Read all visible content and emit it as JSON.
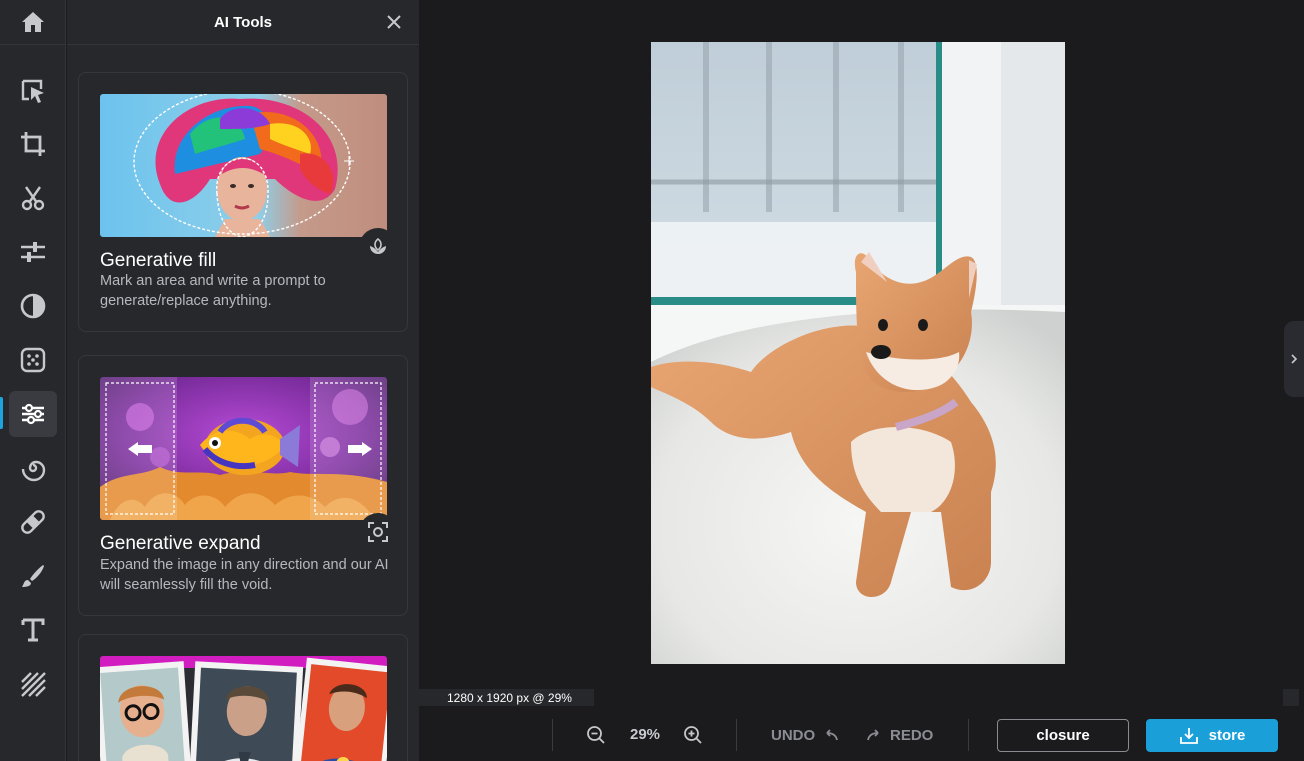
{
  "panel": {
    "title": "AI Tools",
    "cards": [
      {
        "title": "Generative fill",
        "description": "Mark an area and write a prompt to generate/replace anything.",
        "badge_icon": "sprout-icon"
      },
      {
        "title": "Generative expand",
        "description": "Expand the image in any direction and our AI will seamlessly fill the void.",
        "badge_icon": "focus-frame-icon"
      }
    ]
  },
  "sidebar": {
    "items": [
      {
        "name": "home",
        "icon": "home-icon"
      },
      {
        "name": "select",
        "icon": "cursor-select-icon"
      },
      {
        "name": "crop",
        "icon": "crop-icon"
      },
      {
        "name": "cut",
        "icon": "scissors-icon"
      },
      {
        "name": "adjust",
        "icon": "sliders-icon"
      },
      {
        "name": "filters",
        "icon": "contrast-icon"
      },
      {
        "name": "effects",
        "icon": "dots-grid-icon"
      },
      {
        "name": "ai-tools",
        "icon": "ai-tools-icon",
        "active": true
      },
      {
        "name": "spiral",
        "icon": "spiral-icon"
      },
      {
        "name": "retouch",
        "icon": "bandage-icon"
      },
      {
        "name": "draw",
        "icon": "brush-icon"
      },
      {
        "name": "text",
        "icon": "text-icon"
      },
      {
        "name": "pattern",
        "icon": "stripes-icon"
      }
    ]
  },
  "canvas": {
    "dimensions_label": "1280 x 1920 px @ 29%"
  },
  "toolbar": {
    "zoom_value": "29%",
    "undo_label": "UNDO",
    "redo_label": "REDO",
    "close_label": "closure",
    "store_label": "store"
  },
  "colors": {
    "accent": "#1a9fd9",
    "background": "#1b1b1e",
    "panel": "#27282c"
  }
}
